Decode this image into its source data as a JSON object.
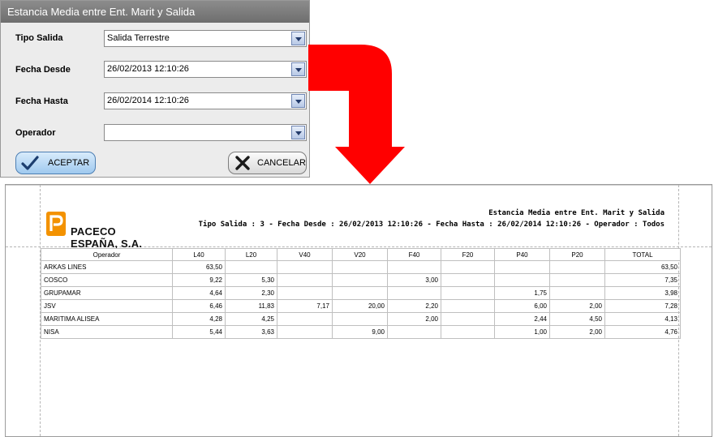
{
  "dialog": {
    "title": "Estancia Media entre Ent. Marit y Salida",
    "fields": [
      {
        "label": "Tipo Salida",
        "value": "Salida Terrestre"
      },
      {
        "label": "Fecha Desde",
        "value": "26/02/2013 12:10:26"
      },
      {
        "label": "Fecha Hasta",
        "value": "26/02/2014 12:10:26"
      },
      {
        "label": "Operador",
        "value": ""
      }
    ],
    "accept_label": "ACEPTAR",
    "cancel_label": "CANCELAR"
  },
  "report": {
    "logo_text": "PACECO ESPAÑA, S.A.",
    "title": "Estancia Media entre Ent. Marit y Salida",
    "params": "Tipo Salida : 3 - Fecha Desde : 26/02/2013 12:10:26 - Fecha Hasta : 26/02/2014 12:10:26 - Operador : Todos",
    "columns": [
      "Operador",
      "L40",
      "L20",
      "V40",
      "V20",
      "F40",
      "F20",
      "P40",
      "P20",
      "TOTAL"
    ],
    "rows": [
      [
        "ARKAS LINES",
        "63,50",
        "",
        "",
        "",
        "",
        "",
        "",
        "",
        "63,50"
      ],
      [
        "COSCO",
        "9,22",
        "5,30",
        "",
        "",
        "3,00",
        "",
        "",
        "",
        "7,35"
      ],
      [
        "GRUPAMAR",
        "4,64",
        "2,30",
        "",
        "",
        "",
        "",
        "1,75",
        "",
        "3,98"
      ],
      [
        "JSV",
        "6,46",
        "11,83",
        "7,17",
        "20,00",
        "2,20",
        "",
        "6,00",
        "2,00",
        "7,28"
      ],
      [
        "MARITIMA ALISEA",
        "4,28",
        "4,25",
        "",
        "",
        "2,00",
        "",
        "2,44",
        "4,50",
        "4,13"
      ],
      [
        "NISA",
        "5,44",
        "3,63",
        "",
        "9,00",
        "",
        "",
        "1,00",
        "2,00",
        "4,76"
      ]
    ]
  },
  "colors": {
    "arrow": "#ff0000",
    "logo": "#f39200",
    "accent": "#4d7fb3"
  },
  "icons": {
    "accept": "checkmark-icon",
    "cancel": "x-icon",
    "arrow": "arrow-down-icon"
  }
}
